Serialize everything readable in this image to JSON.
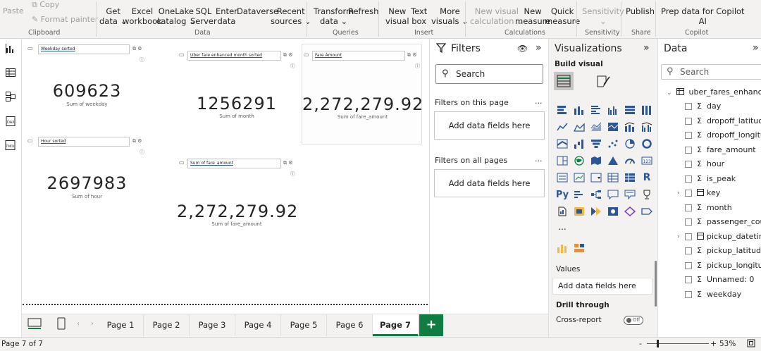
{
  "ribbon": {
    "paste": "Paste",
    "copy": "Copy",
    "format_painter": "Format painter",
    "clipboard": "Clipboard",
    "get_data": "Get",
    "get_data2": "data",
    "excel": "Excel",
    "excel2": "workbook",
    "onelake": "OneLake",
    "onelake2": "catalog",
    "sql": "SQL",
    "sql2": "Server",
    "enter": "Enter",
    "enter2": "data",
    "dataverse": "Dataverse",
    "recent": "Recent",
    "recent2": "sources",
    "data_group": "Data",
    "transform": "Transform",
    "transform2": "data",
    "refresh": "Refresh",
    "queries": "Queries",
    "new_visual": "New",
    "new_visual2": "visual",
    "text_box": "Text",
    "text_box2": "box",
    "more_visuals": "More",
    "more_visuals2": "visuals",
    "insert": "Insert",
    "new_visual_calc": "New visual",
    "new_visual_calc2": "calculation",
    "new_measure": "New",
    "new_measure2": "measure",
    "quick_measure": "Quick",
    "quick_measure2": "measure",
    "calculations": "Calculations",
    "sensitivity": "Sensitivity",
    "sensitivity_group": "Sensitivity",
    "publish": "Publish",
    "share": "Share",
    "prep_data": "Prep data for Copilot",
    "prep_data2": "AI",
    "copilot": "Copilot"
  },
  "canvas": {
    "cards": [
      {
        "header": "Weekday sorted",
        "value": "609623",
        "caption": "Sum of weekday"
      },
      {
        "header": "Uber fare enhanced month sorted",
        "value": "1256291",
        "caption": "Sum of month"
      },
      {
        "header": "Fare Amount",
        "value": "2,272,279.92",
        "caption": "Sum of fare_amount"
      },
      {
        "header": "Hour sorted",
        "value": "2697983",
        "caption": "Sum of hour"
      },
      {
        "header": "Sum of fare_amount",
        "value": "2,272,279.92",
        "caption": "Sum of fare_amount"
      }
    ]
  },
  "filters": {
    "title": "Filters",
    "search": "Search",
    "on_page": "Filters on this page",
    "on_all": "Filters on all pages",
    "add_fields": "Add data fields here",
    "more": "..."
  },
  "visualizations": {
    "title": "Visualizations",
    "build": "Build visual",
    "values": "Values",
    "add_fields": "Add data fields here",
    "drill": "Drill through",
    "cross_report": "Cross-report",
    "toggle": "Off",
    "more": "..."
  },
  "data_pane": {
    "title": "Data",
    "search": "Search",
    "table": "uber_fares_enhanced",
    "fields": [
      {
        "name": "day",
        "kind": "sigma"
      },
      {
        "name": "dropoff_latitude",
        "kind": "sigma"
      },
      {
        "name": "dropoff_longitu...",
        "kind": "sigma"
      },
      {
        "name": "fare_amount",
        "kind": "sigma"
      },
      {
        "name": "hour",
        "kind": "sigma"
      },
      {
        "name": "is_peak",
        "kind": "sigma"
      },
      {
        "name": "key",
        "kind": "table"
      },
      {
        "name": "month",
        "kind": "sigma"
      },
      {
        "name": "passenger_count",
        "kind": "sigma"
      },
      {
        "name": "pickup_datetime",
        "kind": "table"
      },
      {
        "name": "pickup_latitude",
        "kind": "sigma"
      },
      {
        "name": "pickup_longitude",
        "kind": "sigma"
      },
      {
        "name": "Unnamed: 0",
        "kind": "sigma"
      },
      {
        "name": "weekday",
        "kind": "sigma"
      }
    ]
  },
  "tabs": [
    "Page 1",
    "Page 2",
    "Page 3",
    "Page 4",
    "Page 5",
    "Page 6",
    "Page 7"
  ],
  "active_tab": "Page 7",
  "add_tab": "+",
  "status": {
    "page": "Page 7 of 7",
    "zoom": "53%",
    "minus": "-",
    "plus": "+"
  },
  "colors": {
    "accent_green": "#107c41",
    "ribbon_bg": "#f3f2f1",
    "viz_blue": "#2b5797"
  }
}
